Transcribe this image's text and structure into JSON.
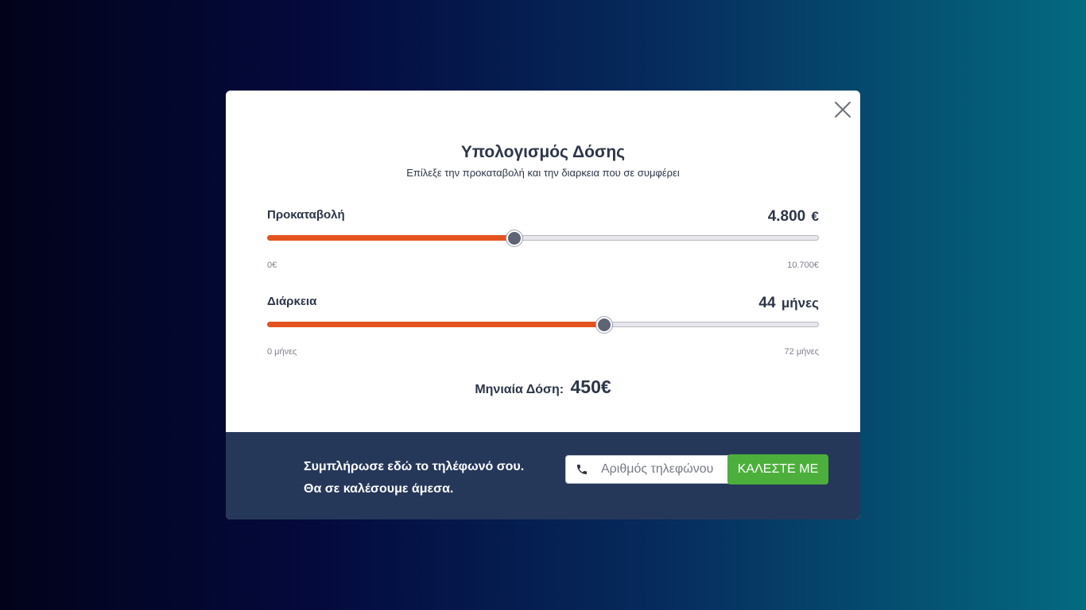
{
  "modal": {
    "title": "Υπολογισμός Δόσης",
    "subtitle": "Επίλεξε την προκαταβολή και την διαρκεια που σε συμφέρει"
  },
  "down_payment": {
    "label": "Προκαταβολή",
    "value": "4.800",
    "unit": "€",
    "min_label": "0€",
    "max_label": "10.700€",
    "min": 0,
    "max": 10700,
    "current": 4800
  },
  "duration": {
    "label": "Διάρκεια",
    "value": "44",
    "unit": "μήνες",
    "min_label": "0 μήνες",
    "max_label": "72 μήνες",
    "min": 0,
    "max": 72,
    "current": 44
  },
  "result": {
    "label": "Μηνιαία Δόση:",
    "amount": "450€"
  },
  "footer": {
    "line1": "Συμπλήρωσε εδώ το τηλέφωνό σου.",
    "line2": "Θα σε καλέσουμε άμεσα.",
    "phone_placeholder": "Αριθμός τηλεφώνου",
    "call_button": "ΚΑΛΕΣΤΕ ΜΕ"
  },
  "colors": {
    "accent_fill": "#e4531f",
    "call_button": "#4caf3c",
    "footer_bg": "#26385a",
    "thumb": "#5e6474"
  },
  "icons": {
    "close": "close-icon",
    "phone": "phone-icon"
  }
}
